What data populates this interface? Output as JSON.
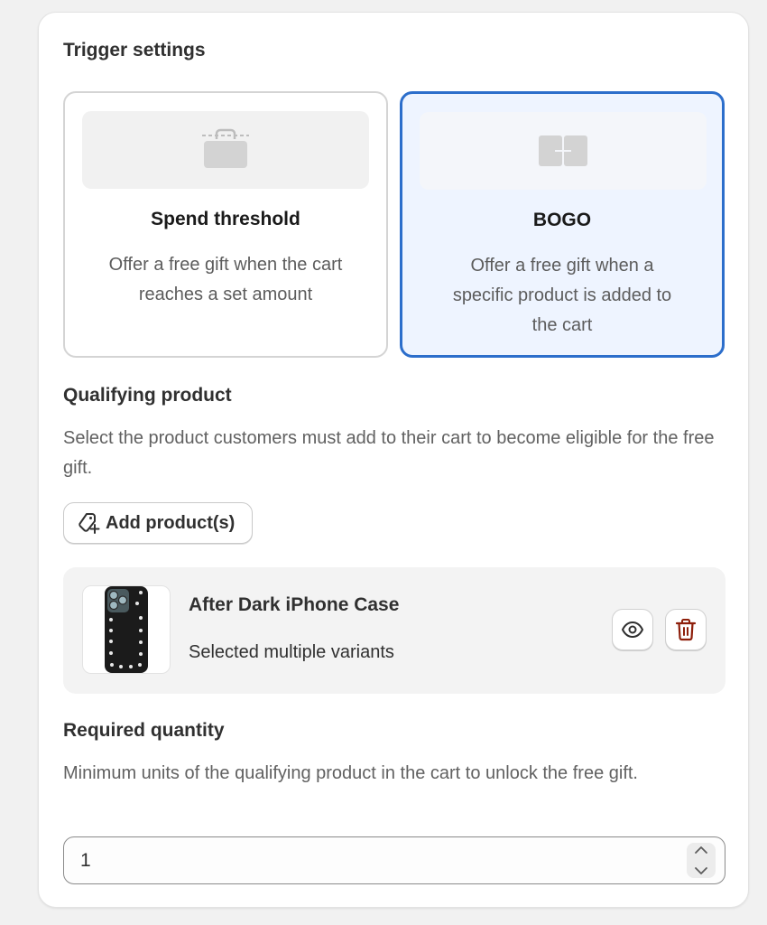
{
  "trigger": {
    "title": "Trigger settings",
    "options": [
      {
        "title": "Spend threshold",
        "description": "Offer a free gift when the cart reaches a set amount",
        "icon": "shopping-bag-icon",
        "selected": false
      },
      {
        "title": "BOGO",
        "description": "Offer a free gift when a specific product is added to the cart",
        "icon": "combine-plus-icon",
        "selected": true
      }
    ]
  },
  "qualifying": {
    "title": "Qualifying product",
    "description": "Select the product customers must add to their cart to become eligible for the free gift.",
    "add_button_label": "Add product(s)",
    "add_button_icon": "tag-plus-icon",
    "product": {
      "name": "After Dark iPhone Case",
      "variants_text": "Selected multiple variants",
      "actions": [
        "eye-icon",
        "trash-icon"
      ]
    }
  },
  "quantity": {
    "title": "Required quantity",
    "description": "Minimum units of the qualifying product in the cart to unlock the free gift.",
    "value": "1"
  },
  "colors": {
    "selected_border": "#2c6ecb",
    "selected_bg": "#eef4ff",
    "delete": "#8e1f0b"
  }
}
